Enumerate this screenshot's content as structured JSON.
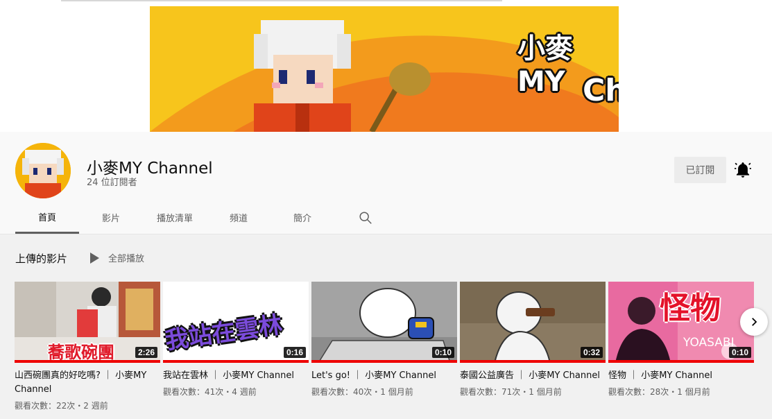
{
  "banner": {
    "title_line1": "小麥MY",
    "title_line2": "Channel"
  },
  "channel": {
    "name": "小麥MY Channel",
    "subscribers": "24 位訂閱者",
    "subscribed_label": "已訂閱"
  },
  "tabs": [
    {
      "label": "首頁"
    },
    {
      "label": "影片"
    },
    {
      "label": "播放清單"
    },
    {
      "label": "頻道"
    },
    {
      "label": "簡介"
    }
  ],
  "section": {
    "title": "上傳的影片",
    "play_all": "全部播放"
  },
  "videos": [
    {
      "title": "山西碗團真的好吃嗎? ｜ 小麥MY Channel",
      "meta": "觀看次數：22次・2 週前",
      "duration": "2:26",
      "overlay": "蕎歌碗團"
    },
    {
      "title": "我站在雲林 ｜ 小麥MY Channel",
      "meta": "觀看次數：41次・4 週前",
      "duration": "0:16",
      "overlay": "我站在雲林"
    },
    {
      "title": "Let's go! ｜ 小麥MY Channel",
      "meta": "觀看次數：40次・1 個月前",
      "duration": "0:10"
    },
    {
      "title": "泰國公益廣告 ｜ 小麥MY Channel",
      "meta": "觀看次數：71次・1 個月前",
      "duration": "0:32"
    },
    {
      "title": "怪物 ｜ 小麥MY Channel",
      "meta": "觀看次數：28次・1 個月前",
      "duration": "0:10",
      "overlay": "怪物",
      "overlay2": "YOASABI"
    }
  ],
  "icons": {
    "bell": "bell-icon",
    "search": "search-icon",
    "play": "play-icon",
    "next": "chevron-right-icon"
  },
  "colors": {
    "progress": "#ee0000",
    "banner_bg": "#f7c51c"
  }
}
